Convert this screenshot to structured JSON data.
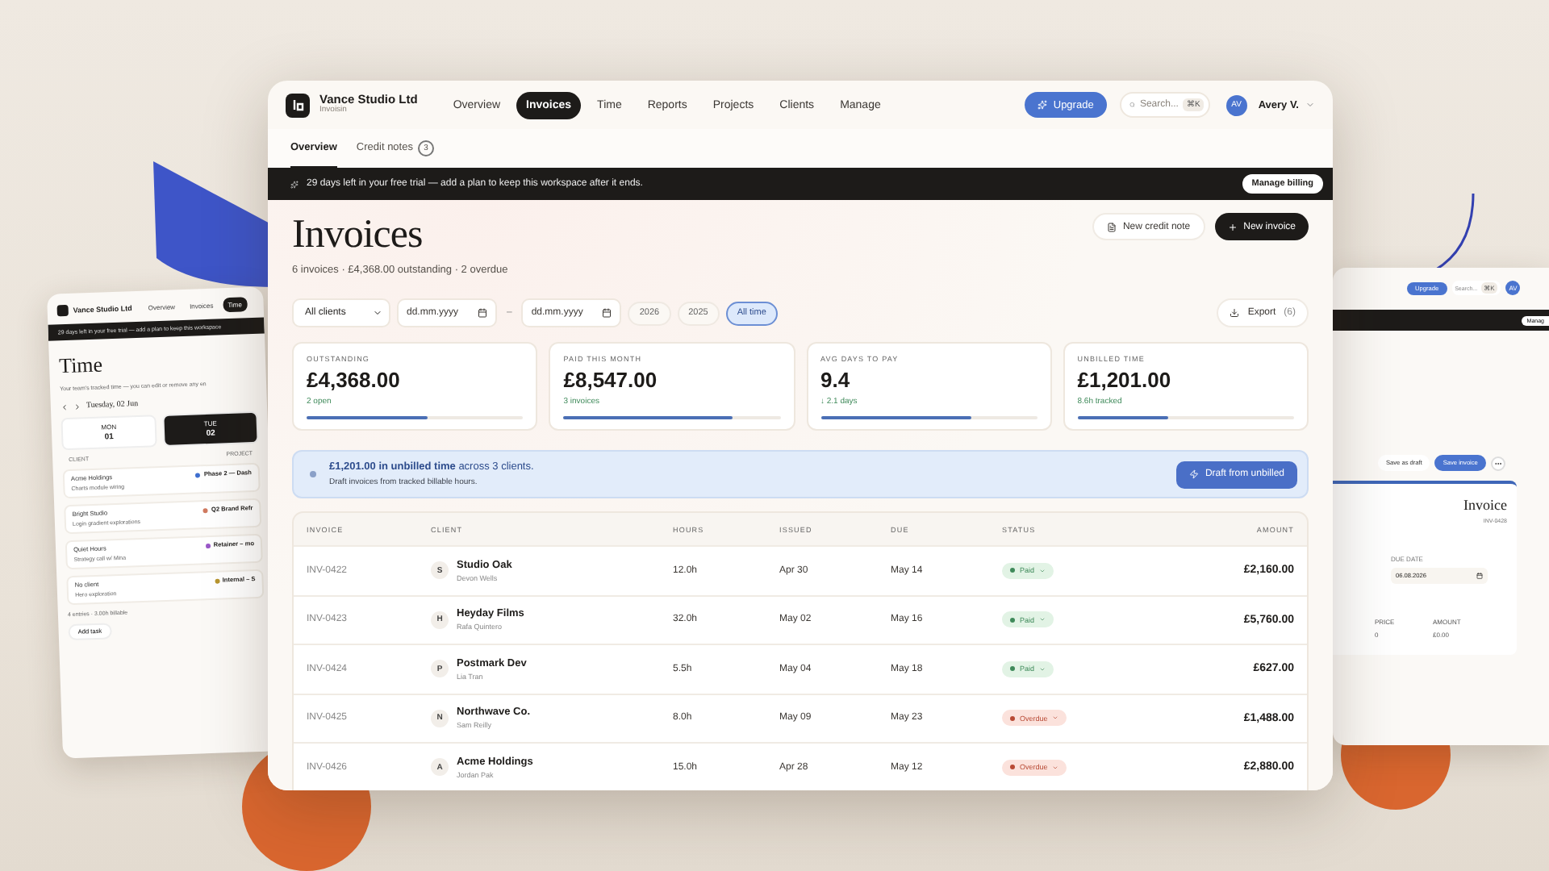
{
  "main_window": {
    "brand": {
      "name": "Vance Studio Ltd",
      "subtitle": "Invoisin"
    },
    "nav": [
      {
        "label": "Overview",
        "selected": false
      },
      {
        "label": "Invoices",
        "selected": true
      },
      {
        "label": "Time",
        "selected": false
      },
      {
        "label": "Reports",
        "selected": false
      },
      {
        "label": "Projects",
        "selected": false
      },
      {
        "label": "Clients",
        "selected": false
      },
      {
        "label": "Manage",
        "selected": false
      }
    ],
    "upgrade": "Upgrade",
    "search": {
      "placeholder": "Search...",
      "shortcut": "⌘K"
    },
    "user": {
      "initials": "AV",
      "name": "Avery V."
    },
    "subtabs": [
      {
        "label": "Overview",
        "selected": true
      },
      {
        "label": "Credit notes",
        "count": "3",
        "selected": false
      }
    ],
    "trial_banner": {
      "text": "29 days left in your free trial — add a plan to keep this workspace after it ends.",
      "button": "Manage billing"
    },
    "page": {
      "title": "Invoices",
      "summary": "6 invoices · £4,368.00 outstanding · 2 overdue",
      "actions": [
        {
          "label": "New credit note",
          "kind": "secondary"
        },
        {
          "label": "New invoice",
          "kind": "primary"
        }
      ]
    },
    "filters": {
      "client": "All clients",
      "date_from": {
        "placeholder": "dd.mm.yyyy"
      },
      "separator": "–",
      "date_to": {
        "placeholder": "dd.mm.yyyy"
      },
      "ranges": [
        {
          "label": "2026",
          "selected": false
        },
        {
          "label": "2025",
          "selected": false
        },
        {
          "label": "All time",
          "selected": true
        }
      ],
      "export": {
        "label": "Export",
        "count": "(6)"
      }
    },
    "stats": [
      {
        "label": "OUTSTANDING",
        "value": "£4,368.00",
        "note": "2 open",
        "level": 0.56
      },
      {
        "label": "PAID THIS MONTH",
        "value": "£8,547.00",
        "note": "3 invoices",
        "level": 0.78
      },
      {
        "label": "AVG DAYS TO PAY",
        "value": "9.4",
        "note": "↓ 2.1 days",
        "level": 0.7
      },
      {
        "label": "UNBILLED TIME",
        "value": "£1,201.00",
        "note": "8.6h tracked",
        "level": 0.42
      }
    ],
    "unbilled_banner": {
      "text": "**£1,201.00 in unbilled time** across 3 clients.",
      "detail": "Draft invoices from tracked billable hours.",
      "button": "Draft from unbilled"
    },
    "table": {
      "columns": [
        "INVOICE",
        "CLIENT",
        "HOURS",
        "ISSUED",
        "DUE",
        "STATUS",
        "AMOUNT"
      ],
      "rows": [
        {
          "invoice": "INV-0422",
          "initial": "S",
          "client": "Studio Oak",
          "contact": "Devon Wells",
          "hours": "12.0h",
          "issued": "Apr 30",
          "due": "May 14",
          "status": {
            "label": "Paid",
            "kind": "paid"
          },
          "amount": "£2,160.00"
        },
        {
          "invoice": "INV-0423",
          "initial": "H",
          "client": "Heyday Films",
          "contact": "Rafa Quintero",
          "hours": "32.0h",
          "issued": "May 02",
          "due": "May 16",
          "status": {
            "label": "Paid",
            "kind": "paid"
          },
          "amount": "£5,760.00"
        },
        {
          "invoice": "INV-0424",
          "initial": "P",
          "client": "Postmark Dev",
          "contact": "Lia Tran",
          "hours": "5.5h",
          "issued": "May 04",
          "due": "May 18",
          "status": {
            "label": "Paid",
            "kind": "paid"
          },
          "amount": "£627.00"
        },
        {
          "invoice": "INV-0425",
          "initial": "N",
          "client": "Northwave Co.",
          "contact": "Sam Reilly",
          "hours": "8.0h",
          "issued": "May 09",
          "due": "May 23",
          "status": {
            "label": "Overdue",
            "kind": "overdue"
          },
          "amount": "£1,488.00"
        },
        {
          "invoice": "INV-0426",
          "initial": "A",
          "client": "Acme Holdings",
          "contact": "Jordan Pak",
          "hours": "15.0h",
          "issued": "Apr 28",
          "due": "May 12",
          "status": {
            "label": "Overdue",
            "kind": "overdue"
          },
          "amount": "£2,880.00"
        }
      ]
    }
  },
  "left_window": {
    "brand": "Vance Studio Ltd",
    "nav": [
      {
        "label": "Overview",
        "selected": false
      },
      {
        "label": "Invoices",
        "selected": false
      },
      {
        "label": "Time",
        "selected": true
      }
    ],
    "banner": "29 days left in your free trial — add a plan to keep this workspace",
    "title": "Time",
    "subtitle": "Your team's tracked time — you can edit or remove any en",
    "date": "Tuesday, 02 Jun",
    "days": [
      {
        "dow": "MON",
        "day": "01",
        "selected": false
      },
      {
        "dow": "TUE",
        "day": "02",
        "selected": true
      }
    ],
    "columns": [
      "CLIENT",
      "PROJECT"
    ],
    "entries": [
      {
        "client": "Acme Holdings",
        "note": "Charts module wiring",
        "project": "Phase 2 — Dash",
        "color": "#3f6fcf"
      },
      {
        "client": "Bright Studio",
        "note": "Login gradient explorations",
        "project": "Q2 Brand Refr",
        "color": "#d07a60"
      },
      {
        "client": "Quiet Hours",
        "note": "Strategy call w/ Mina",
        "project": "Retainer – mo",
        "color": "#9a58c8"
      },
      {
        "client": "No client",
        "note": "Hero exploration",
        "project": "Internal – S",
        "color": "#b8952e"
      }
    ],
    "footer": "4 entries · 3.00h billable",
    "add": "Add task"
  },
  "right_window": {
    "upgrade": "Upgrade",
    "search": "Search...",
    "shortcut": "⌘K",
    "initials": "AV",
    "banner_button": "Manag",
    "actions": [
      {
        "label": "Save as draft",
        "kind": "secondary"
      },
      {
        "label": "Save invoice",
        "kind": "primary"
      }
    ],
    "title": "Invoice",
    "number": "INV-0428",
    "due_label": "DUE DATE",
    "due_value": "06.08.2026",
    "price_label": "PRICE",
    "amount_label": "AMOUNT",
    "price_value": "0",
    "amount_value": "£0.00"
  }
}
